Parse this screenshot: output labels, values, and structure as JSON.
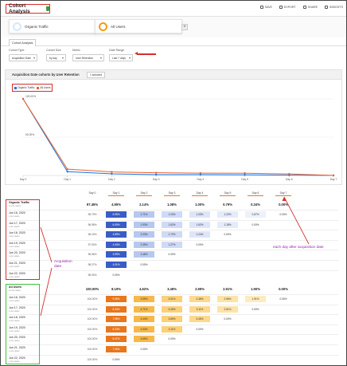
{
  "header": {
    "title": "Cohort Analysis",
    "actions": [
      "SAVE",
      "EXPORT",
      "SHARE",
      "INSIGHTS"
    ]
  },
  "segments": [
    {
      "label": "Organic Traffic",
      "color": "#1a73e8"
    },
    {
      "label": "All Users",
      "color": "#f39c12"
    }
  ],
  "add_segment": "+",
  "tab": "Cohort Analysis",
  "controls": [
    {
      "label": "Cohort Type",
      "value": "Acquisition Date"
    },
    {
      "label": "Cohort Size",
      "value": "by day"
    },
    {
      "label": "Metric",
      "value": "User Retention"
    },
    {
      "label": "Date Range",
      "value": "Last 7 days"
    }
  ],
  "chart": {
    "title": "Acquisition Date cohorts by User Retention",
    "selector": "1 selected",
    "legend": [
      "Organic Traffic",
      "All Users"
    ]
  },
  "chart_data": {
    "type": "line",
    "x": [
      "Day 0",
      "Day 1",
      "Day 2",
      "Day 3",
      "Day 4",
      "Day 5",
      "Day 6",
      "Day 7"
    ],
    "yticks": [
      "100.00%",
      "50.00%"
    ],
    "ylim": [
      0,
      100
    ],
    "series": [
      {
        "name": "Organic Traffic",
        "color": "#1a73e8",
        "values": [
          100,
          4.95,
          2.14,
          1.08,
          1.0,
          0.79,
          0.34,
          0.0
        ]
      },
      {
        "name": "All Users",
        "color": "#e8622c",
        "values": [
          100,
          8.19,
          4.62,
          3.48,
          2.99,
          2.91,
          1.9,
          0.0
        ]
      }
    ]
  },
  "table": {
    "columns": [
      "Day 0",
      "Day 1",
      "Day 2",
      "Day 3",
      "Day 4",
      "Day 5",
      "Day 6",
      "Day 7"
    ],
    "groups": [
      {
        "name": "Organic Traffic",
        "sub": "xx,xxx users",
        "totals": [
          "97.45%",
          "4.95%",
          "2.14%",
          "1.08%",
          "1.00%",
          "0.79%",
          "0.34%",
          "0.00%"
        ],
        "rows": [
          {
            "date": "Jun 16, 2020",
            "sub": "x,xxx users",
            "cells": [
              "95.79%",
              "5.95%",
              "1.71%",
              "1.03%",
              "1.03%",
              "1.22%",
              "0.67%",
              "0.00%"
            ]
          },
          {
            "date": "Jun 17, 2020",
            "sub": "x,xxx users",
            "cells": [
              "96.98%",
              "6.09%",
              "1.93%",
              "1.62%",
              "1.62%",
              "1.18%",
              "0.00%"
            ]
          },
          {
            "date": "Jun 18, 2020",
            "sub": "x,xxx users",
            "cells": [
              "96.15%",
              "4.89%",
              "2.03%",
              "1.72%",
              "1.24%",
              "0.00%"
            ]
          },
          {
            "date": "Jun 19, 2020",
            "sub": "x,xxx users",
            "cells": [
              "97.93%",
              "4.34%",
              "2.39%",
              "1.27%",
              "0.00%"
            ]
          },
          {
            "date": "Jun 20, 2020",
            "sub": "x,xxx users",
            "cells": [
              "96.56%",
              "3.99%",
              "2.46%",
              "0.00%"
            ]
          },
          {
            "date": "Jun 21, 2020",
            "sub": "x,xxx users",
            "cells": [
              "98.27%",
              "4.01%",
              "0.00%"
            ]
          },
          {
            "date": "Jun 22, 2020",
            "sub": "x,xxx users",
            "cells": [
              "96.93%",
              "0.00%"
            ]
          }
        ]
      },
      {
        "name": "All Users",
        "sub": "xx,xxx users",
        "totals": [
          "100.00%",
          "8.19%",
          "4.62%",
          "3.48%",
          "2.99%",
          "2.91%",
          "1.90%",
          "0.00%"
        ],
        "rows": [
          {
            "date": "Jun 16, 2020",
            "sub": "x,xxx users",
            "cells": [
              "100.00%",
              "9.35%",
              "3.99%",
              "3.01%",
              "2.46%",
              "2.96%",
              "1.91%",
              "0.00%"
            ]
          },
          {
            "date": "Jun 17, 2020",
            "sub": "x,xxx users",
            "cells": [
              "100.00%",
              "8.34%",
              "4.71%",
              "3.40%",
              "3.11%",
              "2.61%",
              "0.00%"
            ]
          },
          {
            "date": "Jun 18, 2020",
            "sub": "x,xxx users",
            "cells": [
              "100.00%",
              "7.98%",
              "4.44%",
              "3.80%",
              "3.46%",
              "0.00%"
            ]
          },
          {
            "date": "Jun 19, 2020",
            "sub": "x,xxx users",
            "cells": [
              "100.00%",
              "8.23%",
              "4.53%",
              "3.11%",
              "0.00%"
            ]
          },
          {
            "date": "Jun 20, 2020",
            "sub": "x,xxx users",
            "cells": [
              "100.00%",
              "8.47%",
              "4.65%",
              "0.00%"
            ]
          },
          {
            "date": "Jun 21, 2020",
            "sub": "x,xxx users",
            "cells": [
              "100.00%",
              "7.90%",
              "0.00%"
            ]
          },
          {
            "date": "Jun 22, 2020",
            "sub": "x,xxx users",
            "cells": [
              "100.00%",
              "0.00%"
            ]
          }
        ]
      }
    ]
  },
  "annotations": {
    "acquisition": "Acquisition\ndate",
    "each_day": "each day after acquisition date"
  }
}
